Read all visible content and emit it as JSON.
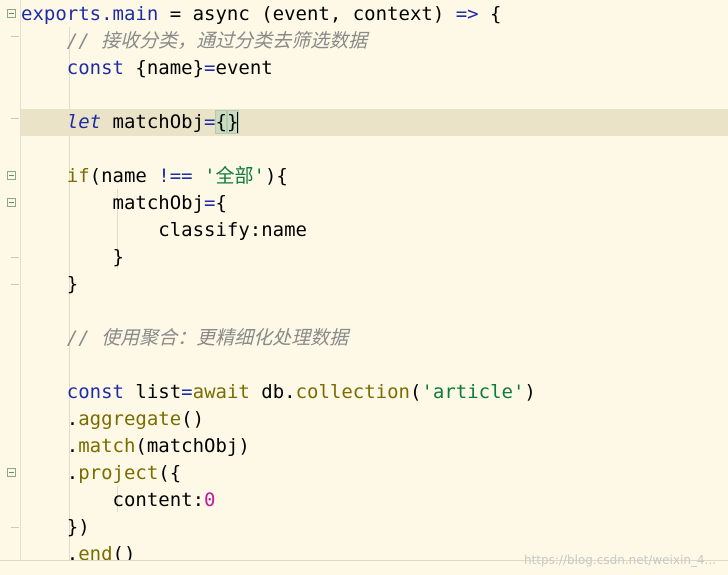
{
  "editor": {
    "lines": [
      {
        "tokens": [
          {
            "t": "exports.",
            "c": "kw"
          },
          {
            "t": "main",
            "c": "kw"
          },
          {
            "t": " = async (event, context) ",
            "c": ""
          },
          {
            "t": "=>",
            "c": "kw"
          },
          {
            "t": " {",
            "c": ""
          }
        ]
      },
      {
        "tokens": [
          {
            "t": "    // 接收分类，通过分类去筛选数据",
            "c": "cmt"
          }
        ]
      },
      {
        "tokens": [
          {
            "t": "    ",
            "c": ""
          },
          {
            "t": "const",
            "c": "kw"
          },
          {
            "t": " {name}",
            "c": ""
          },
          {
            "t": "=",
            "c": "kw"
          },
          {
            "t": "event",
            "c": ""
          }
        ]
      },
      {
        "tokens": []
      },
      {
        "tokens": [
          {
            "t": "    ",
            "c": ""
          },
          {
            "t": "let",
            "c": "kw-i"
          },
          {
            "t": " matchObj",
            "c": ""
          },
          {
            "t": "=",
            "c": "kw"
          },
          {
            "t": "{",
            "c": "brace"
          },
          {
            "t": "}",
            "c": "brace-caret"
          }
        ],
        "current": true
      },
      {
        "tokens": []
      },
      {
        "tokens": [
          {
            "t": "    ",
            "c": ""
          },
          {
            "t": "if",
            "c": "fn"
          },
          {
            "t": "(name ",
            "c": ""
          },
          {
            "t": "!==",
            "c": "kw"
          },
          {
            "t": " ",
            "c": ""
          },
          {
            "t": "'全部'",
            "c": "str"
          },
          {
            "t": "){",
            "c": ""
          }
        ]
      },
      {
        "tokens": [
          {
            "t": "        matchObj",
            "c": ""
          },
          {
            "t": "=",
            "c": "kw"
          },
          {
            "t": "{",
            "c": ""
          }
        ]
      },
      {
        "tokens": [
          {
            "t": "            classify:name",
            "c": ""
          }
        ]
      },
      {
        "tokens": [
          {
            "t": "        }",
            "c": ""
          }
        ]
      },
      {
        "tokens": [
          {
            "t": "    }",
            "c": ""
          }
        ]
      },
      {
        "tokens": []
      },
      {
        "tokens": [
          {
            "t": "    // 使用聚合：更精细化处理数据",
            "c": "cmt"
          }
        ]
      },
      {
        "tokens": []
      },
      {
        "tokens": [
          {
            "t": "    ",
            "c": ""
          },
          {
            "t": "const",
            "c": "kw"
          },
          {
            "t": " list",
            "c": ""
          },
          {
            "t": "=",
            "c": "kw"
          },
          {
            "t": "await",
            "c": "fn"
          },
          {
            "t": " db.",
            "c": ""
          },
          {
            "t": "collection",
            "c": "fn"
          },
          {
            "t": "(",
            "c": ""
          },
          {
            "t": "'article'",
            "c": "str"
          },
          {
            "t": ")",
            "c": ""
          }
        ]
      },
      {
        "tokens": [
          {
            "t": "    .",
            "c": ""
          },
          {
            "t": "aggregate",
            "c": "fn"
          },
          {
            "t": "()",
            "c": ""
          }
        ]
      },
      {
        "tokens": [
          {
            "t": "    .",
            "c": ""
          },
          {
            "t": "match",
            "c": "fn"
          },
          {
            "t": "(matchObj)",
            "c": ""
          }
        ]
      },
      {
        "tokens": [
          {
            "t": "    .",
            "c": ""
          },
          {
            "t": "project",
            "c": "fn"
          },
          {
            "t": "({",
            "c": ""
          }
        ]
      },
      {
        "tokens": [
          {
            "t": "        content:",
            "c": ""
          },
          {
            "t": "0",
            "c": "num"
          }
        ]
      },
      {
        "tokens": [
          {
            "t": "    })",
            "c": ""
          }
        ]
      },
      {
        "tokens": [
          {
            "t": "    .",
            "c": ""
          },
          {
            "t": "end",
            "c": "fn"
          },
          {
            "t": "()",
            "c": ""
          }
        ]
      }
    ]
  },
  "watermark": "https://blog.csdn.net/weixin_4..."
}
